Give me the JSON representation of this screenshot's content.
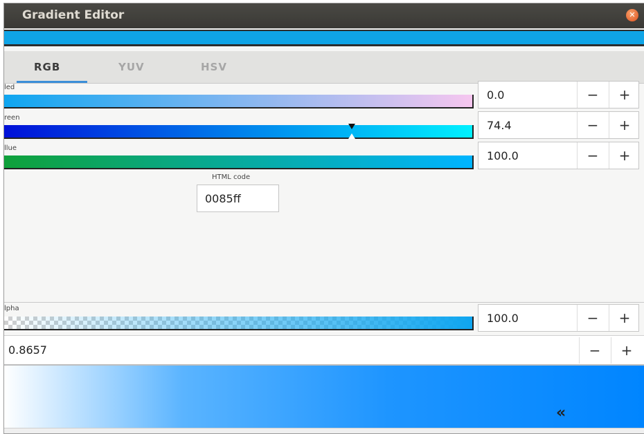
{
  "window": {
    "title": "Gradient Editor"
  },
  "tabs": [
    {
      "label": "RGB",
      "active": true
    },
    {
      "label": "YUV",
      "active": false
    },
    {
      "label": "HSV",
      "active": false
    }
  ],
  "channels": [
    {
      "label": "led",
      "value": "0.0",
      "level": 0.0
    },
    {
      "label": "reen",
      "value": "74.4",
      "level": 0.744
    },
    {
      "label": "llue",
      "value": "100.0",
      "level": 1.0
    }
  ],
  "html_code": {
    "label": "HTML code",
    "value": "0085ff"
  },
  "alpha": {
    "label": "lpha",
    "value": "100.0",
    "level": 1.0
  },
  "position": {
    "value": "0.8657"
  },
  "colors": {
    "accent": "#3b8ed8",
    "current": "#0085ff",
    "strip": "#0fa4e6"
  },
  "buttons": {
    "minus": "−",
    "plus": "+"
  }
}
